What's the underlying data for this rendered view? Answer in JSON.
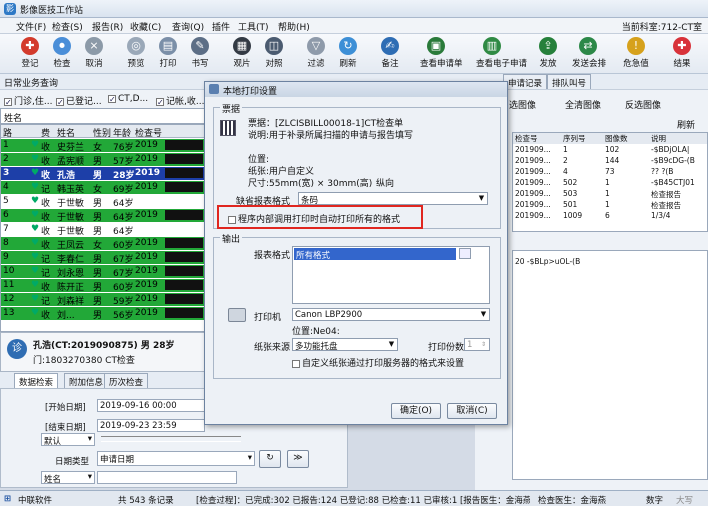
{
  "app": {
    "title": "影像医技工作站",
    "logo": "影"
  },
  "menu": {
    "items": [
      "文件(F)",
      "检查(S)",
      "报告(R)",
      "收藏(C)",
      "查询(Q)",
      "插件",
      "工具(T)",
      "帮助(H)"
    ],
    "current_queue": "当前科室:712-CT室"
  },
  "toolbar": {
    "buttons": [
      "登记",
      "检查",
      "取消",
      "预览",
      "打印",
      "书写",
      "观片",
      "对照",
      "过滤",
      "刷新",
      "备注",
      "查看申请单",
      "查看电子申请",
      "发放",
      "发送会排",
      "危急值",
      "结果",
      "完成"
    ],
    "colors": [
      "#d33b2c",
      "#4a8ed8",
      "#8c9aa8",
      "#9aa8b8",
      "#7b8fa8",
      "#5c6e86",
      "#333a44",
      "#4b5b70",
      "#8e9aaa",
      "#3d8fd6",
      "#2e6db4",
      "#2a7a3a",
      "#2f8a44",
      "#26803b",
      "#2c8848",
      "#d6a11c",
      "#d8323a",
      "#2aa43e"
    ]
  },
  "query": {
    "title": "日常业务查询"
  },
  "filters": [
    "门诊,住...",
    "已登记...",
    "CT,D...",
    "记帐,收..."
  ],
  "name_filter": "姓名",
  "grid": {
    "headers": [
      "路",
      "",
      "",
      "费",
      "姓名",
      "性别",
      "年龄",
      "检查号"
    ],
    "rows": [
      {
        "n": "1",
        "fee": "收",
        "name": "史芬兰",
        "sex": "女",
        "age": "76岁",
        "no": "2019",
        "style": "green"
      },
      {
        "n": "2",
        "fee": "收",
        "name": "孟宪顺",
        "sex": "男",
        "age": "57岁",
        "no": "2019",
        "style": "green"
      },
      {
        "n": "3",
        "fee": "收",
        "name": "孔浩",
        "sex": "男",
        "age": "28岁",
        "no": "2019",
        "style": "sel"
      },
      {
        "n": "4",
        "fee": "记",
        "name": "韩玉英",
        "sex": "女",
        "age": "69岁",
        "no": "2019",
        "style": "green"
      },
      {
        "n": "5",
        "fee": "收",
        "name": "于世敏",
        "sex": "男",
        "age": "64岁",
        "no": "",
        "style": "wh"
      },
      {
        "n": "6",
        "fee": "收",
        "name": "于世敏",
        "sex": "男",
        "age": "64岁",
        "no": "2019",
        "style": "green"
      },
      {
        "n": "7",
        "fee": "收",
        "name": "于世敏",
        "sex": "男",
        "age": "64岁",
        "no": "",
        "style": "wh"
      },
      {
        "n": "8",
        "fee": "收",
        "name": "王凤云",
        "sex": "女",
        "age": "60岁",
        "no": "2019",
        "style": "green"
      },
      {
        "n": "9",
        "fee": "记",
        "name": "李春仁",
        "sex": "男",
        "age": "67岁",
        "no": "2019",
        "style": "green"
      },
      {
        "n": "10",
        "fee": "记",
        "name": "刘永恩",
        "sex": "男",
        "age": "67岁",
        "no": "2019",
        "style": "green"
      },
      {
        "n": "11",
        "fee": "收",
        "name": "陈开正",
        "sex": "男",
        "age": "60岁",
        "no": "2019",
        "style": "green"
      },
      {
        "n": "12",
        "fee": "记",
        "name": "刘森祥",
        "sex": "男",
        "age": "59岁",
        "no": "2019",
        "style": "green"
      },
      {
        "n": "13",
        "fee": "收",
        "name": "刘...",
        "sex": "男",
        "age": "56岁",
        "no": "2019",
        "style": "green"
      }
    ]
  },
  "patient": {
    "line1": "孔浩(CT:2019090875)  男  28岁",
    "line2": "门:1803270380  CT检查",
    "badge": "诊"
  },
  "bottom_tabs": [
    "数据检索",
    "附加信息",
    "历次检查"
  ],
  "search": {
    "start_label": "[开始日期]",
    "start_value": "2019-09-16 00:00",
    "end_label": "[结束日期]",
    "end_value": "2019-09-23 23:59",
    "default_value": "默认",
    "datetype_label": "日期类型",
    "datetype_value": "申请日期",
    "name_value": "姓名"
  },
  "right": {
    "tabs": [
      "申请记录",
      "排队叫号"
    ],
    "btn_all": "全清图像",
    "btn_rev": "反选图像",
    "btn_sel": "选图像",
    "btn_refresh": "刷新",
    "headers": [
      "检查号",
      "序列号",
      "图像数",
      "说明"
    ],
    "rows": [
      [
        "201909...",
        "1",
        "102",
        "-$BDjOLA|"
      ],
      [
        "201909...",
        "2",
        "144",
        "-$B9cDG-(B"
      ],
      [
        "201909...",
        "4",
        "73",
        "?? ?(B"
      ],
      [
        "201909...",
        "502",
        "1",
        "-$B45CTJ01"
      ],
      [
        "201909...",
        "503",
        "1",
        "检查报告"
      ],
      [
        "201909...",
        "501",
        "1",
        "检查报告"
      ],
      [
        "201909...",
        "1009",
        "6",
        "1/3/4"
      ]
    ],
    "extra": "20    -$BLp>uOL-(B"
  },
  "dialog": {
    "title": "本地打印设置",
    "doc_group": "票据",
    "doc_name": "票据：[ZLCISBILL00018-1]CT检查单",
    "doc_desc": "说明:用于补录所属扫描的申请与报告填写",
    "position": "位置:",
    "paper": "纸张:用户自定义",
    "size_label": "尺寸:55mm(宽) × 30mm(高)",
    "orientation": "纵向",
    "default_format_label": "缺省报表格式",
    "default_format_value": "条码",
    "auto_all_label": "程序内部调用打印时自动打印所有的格式",
    "output_group": "输出",
    "report_format_label": "报表格式",
    "report_format_value": "所有格式",
    "printer_label": "打印机",
    "printer_value": "Canon LBP2900",
    "printer_location": "位置:Ne04:",
    "source_label": "纸张来源",
    "source_value": "多功能托盘",
    "copies_label": "打印份数",
    "copies_value": "1",
    "custom_paper_label": "自定义纸张通过打印服务器的格式来设置",
    "ok": "确定(O)",
    "cancel": "取消(C)"
  },
  "status": {
    "company": "中联软件",
    "total": "共 543 条记录",
    "progress": "[检查过程]：已完成:302  已报告:124  已登记:88  已检查:11  已审核:1  [报告医生：金海燕",
    "doctor": "检查医生：金海燕",
    "mode": "数字",
    "caps": "大写"
  }
}
